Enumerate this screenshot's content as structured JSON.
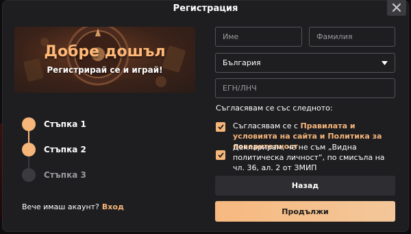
{
  "dialog": {
    "title": "Регистрация"
  },
  "banner": {
    "title": "Добре дошъл",
    "subtitle": "Регистрирай се и играй!"
  },
  "stepper": {
    "steps": [
      {
        "label": "Стъпка 1",
        "active": true
      },
      {
        "label": "Стъпка 2",
        "active": true
      },
      {
        "label": "Стъпка 3",
        "active": false
      }
    ]
  },
  "login": {
    "prompt": "Вече имаш акаунт?",
    "link": "Вход"
  },
  "form": {
    "first_name_placeholder": "Име",
    "last_name_placeholder": "Фамилия",
    "country_value": "България",
    "id_placeholder": "ЕГН/ЛНЧ",
    "agree_heading": "Съгласявам се със следното:",
    "agree_terms_prefix": "Съгласявам се с ",
    "agree_terms_link": "Правилата и условията на сайта и Политика за поверителност",
    "declare_text": "Декларирам, че не съм „Видна политическа личност“, по смисъла на чл. 36, ал. 2 от ЗМИП",
    "back_label": "Назад",
    "next_label": "Продължи"
  },
  "colors": {
    "accent": "#f6b579",
    "background": "#1e1e21",
    "inactive": "#3a3a3f"
  },
  "icons": {
    "close": "close-icon",
    "dropdown": "caret-down-icon",
    "check": "check-icon"
  }
}
